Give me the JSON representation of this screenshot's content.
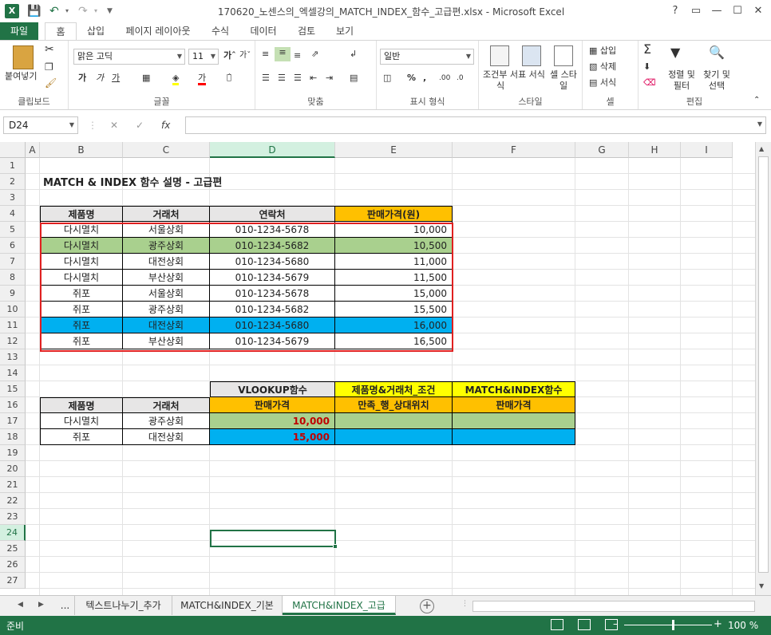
{
  "window": {
    "title": "170620_노센스의_엑셀강의_MATCH_INDEX_함수_고급편.xlsx - Microsoft Excel",
    "app_icon": "X",
    "controls": [
      "?",
      "▭",
      "—",
      "☐",
      "✕"
    ]
  },
  "ribbon_tabs": [
    "파일",
    "홈",
    "삽입",
    "페이지 레이아웃",
    "수식",
    "데이터",
    "검토",
    "보기"
  ],
  "ribbon": {
    "clipboard": {
      "paste": "붙여넣기",
      "label": "클립보드"
    },
    "font": {
      "name": "맑은 고딕",
      "size": "11",
      "bold": "가",
      "italic": "가",
      "underline": "가",
      "label": "글꼴"
    },
    "alignment": {
      "label": "맞춤"
    },
    "number": {
      "format": "일반",
      "label": "표시 형식"
    },
    "styles": {
      "conditional": "조건부 서식",
      "table": "표 서식",
      "cell": "셀 스타일",
      "label": "스타일"
    },
    "cells": {
      "insert": "삽입",
      "delete": "삭제",
      "format": "서식",
      "label": "셀"
    },
    "editing": {
      "sort": "정렬 및 필터",
      "find": "찾기 및 선택",
      "label": "편집"
    }
  },
  "formula_bar": {
    "name_box": "D24",
    "fx": "fx",
    "value": ""
  },
  "columns": [
    "A",
    "B",
    "C",
    "D",
    "E",
    "F",
    "G",
    "H",
    "I"
  ],
  "rows": [
    "1",
    "2",
    "3",
    "4",
    "5",
    "6",
    "7",
    "8",
    "9",
    "10",
    "11",
    "12",
    "13",
    "14",
    "15",
    "16",
    "17",
    "18",
    "19",
    "20",
    "21",
    "22",
    "23",
    "24",
    "25",
    "26",
    "27"
  ],
  "sheet": {
    "title": "MATCH & INDEX 함수 설명 - 고급편",
    "table1": {
      "headers": [
        "제품명",
        "거래처",
        "연락처",
        "판매가격(원)"
      ],
      "rows": [
        [
          "다시멸치",
          "서울상회",
          "010-1234-5678",
          "10,000"
        ],
        [
          "다시멸치",
          "광주상회",
          "010-1234-5682",
          "10,500"
        ],
        [
          "다시멸치",
          "대전상회",
          "010-1234-5680",
          "11,000"
        ],
        [
          "다시멸치",
          "부산상회",
          "010-1234-5679",
          "11,500"
        ],
        [
          "쥐포",
          "서울상회",
          "010-1234-5678",
          "15,000"
        ],
        [
          "쥐포",
          "광주상회",
          "010-1234-5682",
          "15,500"
        ],
        [
          "쥐포",
          "대전상회",
          "010-1234-5680",
          "16,000"
        ],
        [
          "쥐포",
          "부산상회",
          "010-1234-5679",
          "16,500"
        ]
      ]
    },
    "table2": {
      "group_headers": [
        "VLOOKUP함수",
        "제품명&거래처_조건",
        "MATCH&INDEX함수"
      ],
      "headers": [
        "제품명",
        "거래처",
        "판매가격",
        "만족_행_상대위치",
        "판매가격"
      ],
      "rows": [
        [
          "다시멸치",
          "광주상회",
          "10,000",
          "",
          ""
        ],
        [
          "쥐포",
          "대전상회",
          "15,000",
          "",
          ""
        ]
      ]
    },
    "colors": {
      "header_orange": "#ffc000",
      "green": "#a9d08e",
      "blue": "#00b0f0",
      "yellow": "#ffff00",
      "gray": "#e7e6e6",
      "red_text": "#c00000"
    }
  },
  "sheet_tabs": {
    "overflow": "...",
    "tabs": [
      "텍스트나누기_추가",
      "MATCH&INDEX_기본",
      "MATCH&INDEX_고급"
    ],
    "active": 2
  },
  "status": {
    "ready": "준비",
    "zoom": "100 %"
  }
}
